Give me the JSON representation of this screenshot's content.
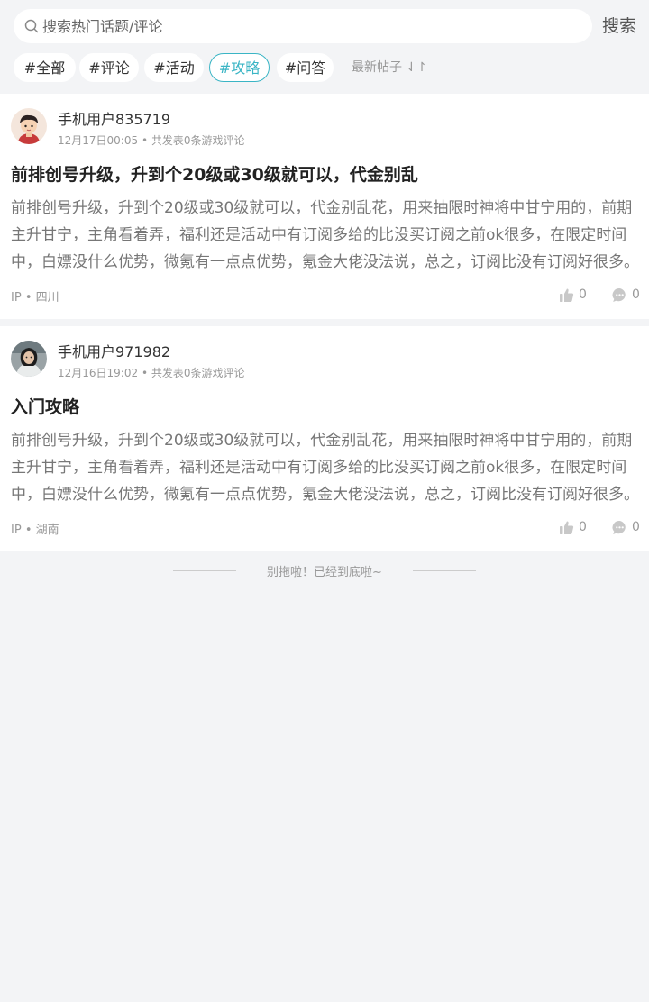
{
  "search": {
    "placeholder": "搜索热门话题/评论",
    "button_label": "搜索"
  },
  "tags": [
    {
      "label": "#全部",
      "active": false
    },
    {
      "label": "#评论",
      "active": false
    },
    {
      "label": "#活动",
      "active": false
    },
    {
      "label": "#攻略",
      "active": true
    },
    {
      "label": "#问答",
      "active": false
    }
  ],
  "sort": {
    "label": "最新帖子 ⇃↾"
  },
  "posts": [
    {
      "username": "手机用户835719",
      "time": "12月17日00:05",
      "meta_suffix": "共发表0条游戏评论",
      "title": "前排创号升级，升到个20级或30级就可以，代金别乱",
      "body": "前排创号升级，升到个20级或30级就可以，代金别乱花，用来抽限时神将中甘宁用的，前期主升甘宁，主角看着弄，福利还是活动中有订阅多给的比没买订阅之前ok很多，在限定时间中，白嫖没什么优势，微氪有一点点优势，氪金大佬没法说，总之，订阅比没有订阅好很多。",
      "ip_label": "IP",
      "location": "四川",
      "likes": "0",
      "comments": "0",
      "avatar_icon": "cartoon-avatar-icon"
    },
    {
      "username": "手机用户971982",
      "time": "12月16日19:02",
      "meta_suffix": "共发表0条游戏评论",
      "title": "入门攻略",
      "body": "前排创号升级，升到个20级或30级就可以，代金别乱花，用来抽限时神将中甘宁用的，前期主升甘宁，主角看着弄，福利还是活动中有订阅多给的比没买订阅之前ok很多，在限定时间中，白嫖没什么优势，微氪有一点点优势，氪金大佬没法说，总之，订阅比没有订阅好很多。",
      "ip_label": "IP",
      "location": "湖南",
      "likes": "0",
      "comments": "0",
      "avatar_icon": "photo-avatar-icon"
    }
  ],
  "footer": {
    "end_text": "别拖啦！已经到底啦~"
  },
  "colors": {
    "accent": "#3ab5c5",
    "background": "#f3f4f6",
    "card": "#ffffff",
    "muted": "#999999"
  }
}
